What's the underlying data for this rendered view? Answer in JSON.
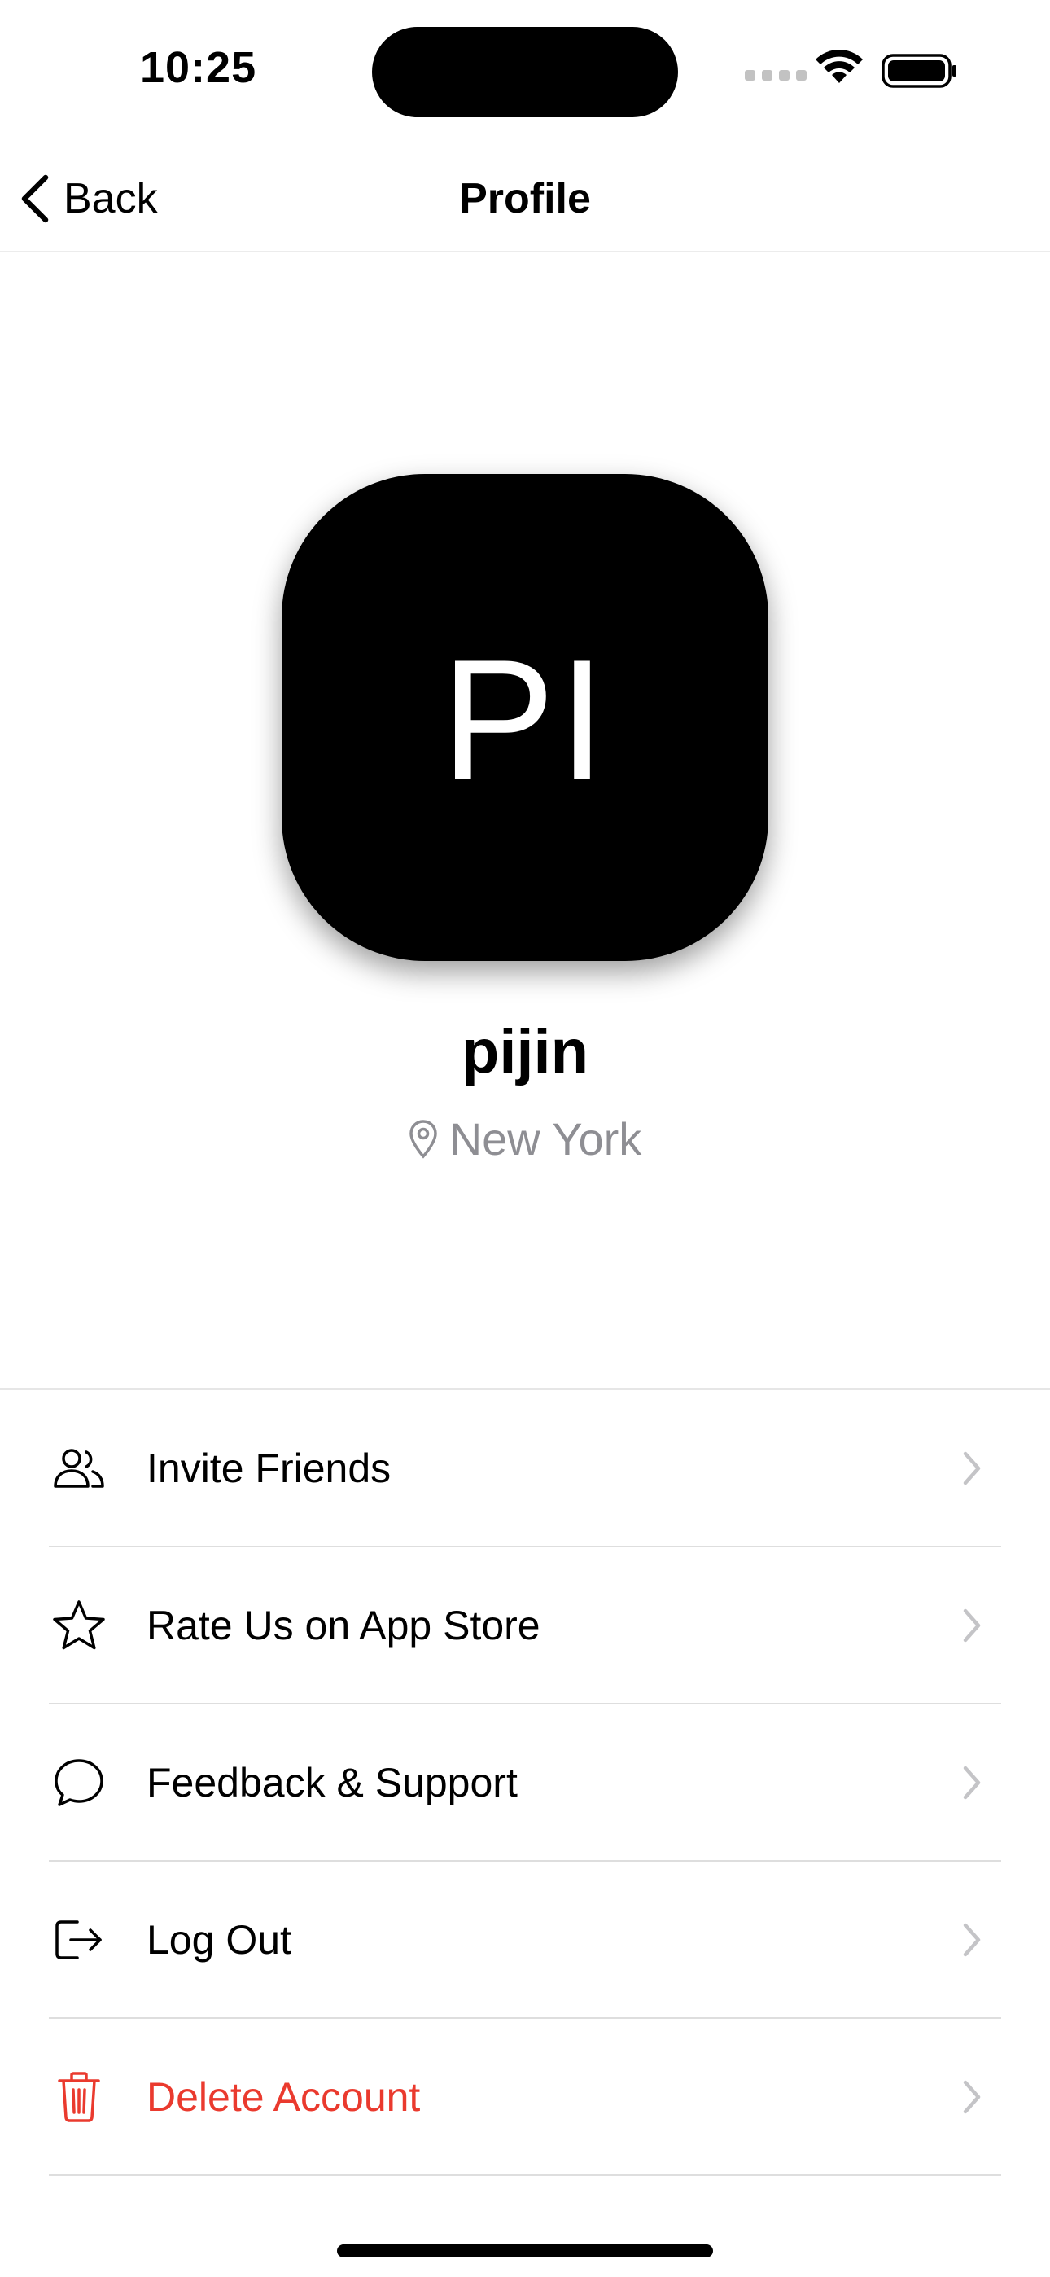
{
  "status_bar": {
    "time": "10:25"
  },
  "nav": {
    "back_label": "Back",
    "title": "Profile"
  },
  "profile": {
    "initials": "PI",
    "username": "pijin",
    "location": "New York",
    "avatar_color": "#000000"
  },
  "menu": {
    "items": [
      {
        "label": "Invite Friends",
        "icon": "people-icon"
      },
      {
        "label": "Rate Us on App Store",
        "icon": "star-icon"
      },
      {
        "label": "Feedback & Support",
        "icon": "chat-bubble-icon"
      },
      {
        "label": "Log Out",
        "icon": "logout-icon"
      },
      {
        "label": "Delete Account",
        "icon": "trash-icon",
        "destructive": true
      }
    ]
  },
  "colors": {
    "destructive": "#ea3a2e",
    "secondary_text": "#8e8e93",
    "chevron": "#c4c4c7"
  }
}
